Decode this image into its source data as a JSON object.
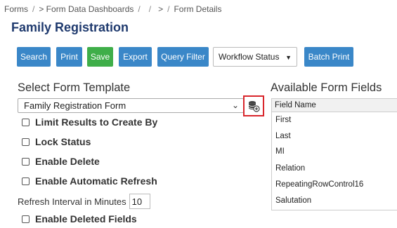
{
  "breadcrumb": {
    "items": [
      "Forms",
      "> Form Data Dashboards",
      "",
      "> ",
      "Form Details"
    ],
    "separator": "/"
  },
  "page": {
    "title": "Family Registration"
  },
  "toolbar": {
    "search": "Search",
    "print": "Print",
    "save": "Save",
    "export": "Export",
    "query_filter": "Query Filter",
    "workflow_status": "Workflow Status",
    "batch_print": "Batch Print"
  },
  "template": {
    "heading": "Select Form Template",
    "selected": "Family Registration Form"
  },
  "options": {
    "limit_results": "Limit Results to Create By",
    "lock_status": "Lock Status",
    "enable_delete": "Enable Delete",
    "enable_auto_refresh": "Enable Automatic Refresh",
    "refresh_interval_label": "Refresh Interval in Minutes",
    "refresh_interval_value": "10",
    "enable_deleted_fields": "Enable Deleted Fields"
  },
  "fields": {
    "heading": "Available Form Fields",
    "column_header": "Field Name",
    "items": [
      "First",
      "Last",
      "MI",
      "Relation",
      "RepeatingRowControl16",
      "Salutation"
    ]
  },
  "colors": {
    "primary_button": "#3a87c8",
    "save_button": "#3fae49",
    "title": "#1f3a6e",
    "highlight": "#d9262c"
  }
}
